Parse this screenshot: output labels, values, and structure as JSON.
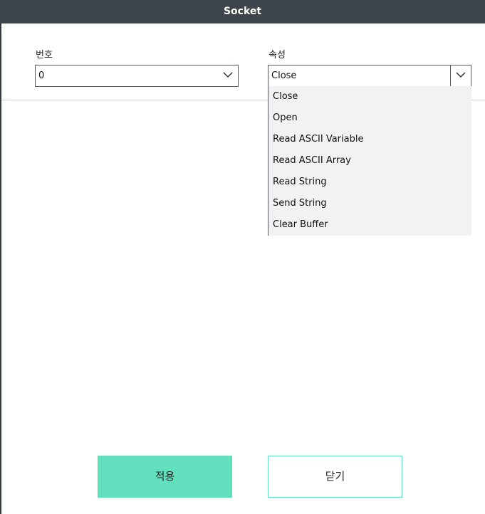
{
  "dialog": {
    "title": "Socket"
  },
  "fields": {
    "number": {
      "label": "번호",
      "value": "0"
    },
    "property": {
      "label": "속성",
      "value": "Close",
      "options": [
        "Close",
        "Open",
        "Read ASCII Variable",
        "Read ASCII Array",
        "Read String",
        "Send String",
        "Clear Buffer"
      ]
    }
  },
  "buttons": {
    "apply_label": "적용",
    "close_label": "닫기"
  },
  "icons": {
    "dropdown": "chevron-down-icon"
  },
  "colors": {
    "titlebar": "#3d444b",
    "accent": "#63e0bd",
    "dropdown_bg": "#f2f2f2"
  }
}
